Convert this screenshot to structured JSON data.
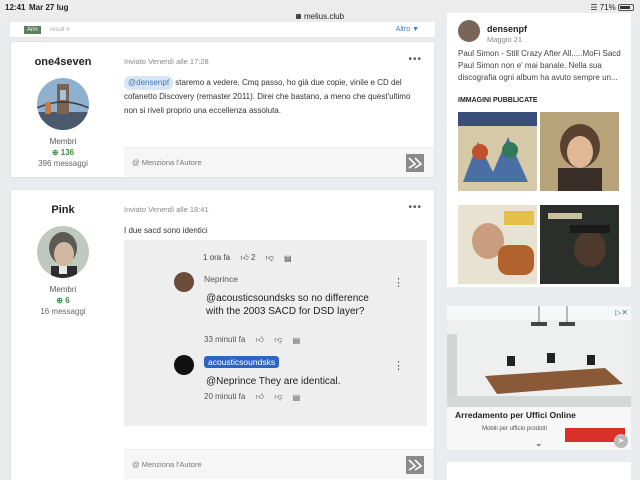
{
  "status_bar": {
    "time": "12:41",
    "date": "Mar 27 lug",
    "url": "melius.club",
    "battery": "71%"
  },
  "top_strip": {
    "badge": "Ann",
    "result": "result #",
    "altro": "Altro"
  },
  "posts": [
    {
      "author": "one4seven",
      "group": "Membri",
      "reputation": "136",
      "messages": "396 messaggi",
      "meta": "Inviato Venerdì alle 17:28",
      "mention": "@densenpf",
      "text": " staremo a vedere. Cmq passo, ho già due copie, vinile e CD del cofanetto Discovery (remaster 2011).  Direi che bastano, a meno che quest'ultimo non si riveli proprio una eccellenza assoluta.",
      "footer_mention": "Menziona l'Autore"
    },
    {
      "author": "Pink",
      "group": "Membri",
      "reputation": "6",
      "messages": "16 messaggi",
      "meta": "Inviato Venerdì alle 18:41",
      "text": "I due sacd sono identici",
      "footer_mention": "Menziona l'Autore"
    }
  ],
  "embed": {
    "top_row": {
      "time": "1 ora fa",
      "likes": "2"
    },
    "comments": [
      {
        "user": "Neprince",
        "text": " @acousticsoundsks  so no difference with the 2003 SACD for DSD layer?",
        "time": "33 minuti fa"
      },
      {
        "user": "acousticsoundsks",
        "text": "@Neprince  They are identical.",
        "time": "20 minuti fa"
      }
    ]
  },
  "sidebar": {
    "user": "densenpf",
    "date": "Maggio 21",
    "text": "Paul Simon - Still Crazy After All.....MoFi Sacd Paul Simon non e' mai banale.  Nella sua discografia ogni album ha avuto sempre un...",
    "images_heading": "IMMAGINI PUBBLICATE"
  },
  "ad": {
    "title": "Arredamento per Uffici Online",
    "subtitle": "Mobili per ufficio prodotti"
  },
  "colors": {
    "accent": "#3c7ab8",
    "rep_green": "#3e8f3e",
    "tag_blue": "#2f64c4"
  }
}
